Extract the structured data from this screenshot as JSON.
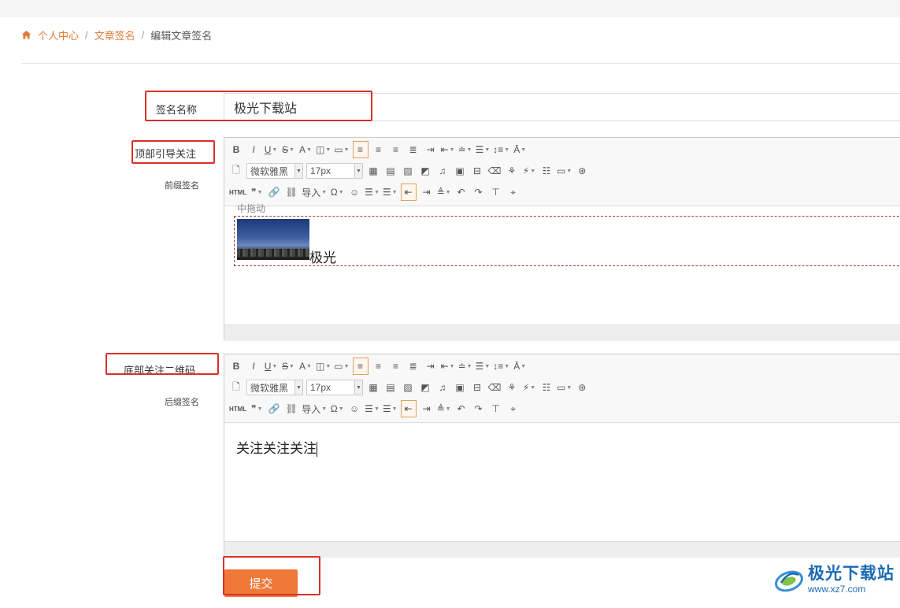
{
  "breadcrumb": {
    "home": "个人中心",
    "sep1": "/",
    "section": "文章签名",
    "sep2": "/",
    "current": "编辑文章签名"
  },
  "form": {
    "name_label": "签名名称",
    "name_value": "极光下载站",
    "prefix_label": "顶部引导关注",
    "prefix_sublabel": "前缀签名",
    "suffix_label": "底部关注二维码",
    "suffix_sublabel": "后缀签名",
    "submit_label": "提交"
  },
  "editor": {
    "html_label": "HTML",
    "import_label": "导入",
    "font_family": "微软雅黑",
    "font_size": "17px"
  },
  "editor1": {
    "drag_hint": "中拖动",
    "content_text": "极光"
  },
  "editor2": {
    "content_text": "关注关注关注"
  },
  "watermark": {
    "title": "极光下载站",
    "url": "www.xz7.com"
  },
  "colors": {
    "accent": "#f07838",
    "link": "#e07b39",
    "highlight_box": "#d9302b"
  }
}
